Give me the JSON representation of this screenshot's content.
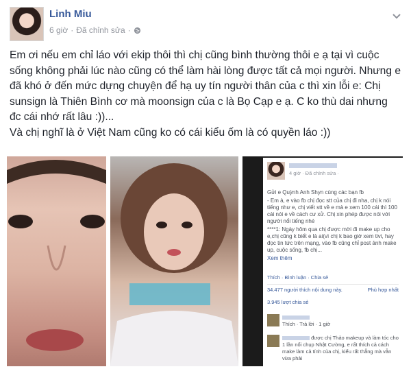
{
  "post": {
    "author": "Linh Miu",
    "time": "6 giờ",
    "separator": "·",
    "edited": "Đã chỉnh sửa",
    "privacy_sep": "·",
    "icons": {
      "privacy": "globe-icon",
      "menu": "chevron-down-icon"
    },
    "paragraphs": [
      "Em ơi nếu em chỉ láo với ekip thôi thì chị cũng bình thường thôi e ạ tại vì cuộc sống không phải lúc nào cũng có thể làm hài lòng được tất cả mọi người. Nhưng e đã khó ở đến mức dựng chuyện để hạ uy tín người thân của c thì xin lỗi e: Chị sunsign là Thiên Bình cơ mà moonsign của c là Bọ Cạp e ạ. C ko thù dai nhưng đc cái nhớ rất lâu :))...",
      "Và chị nghĩ là ở Việt Nam cũng ko có cái kiểu ốm là có quyền láo :))"
    ]
  },
  "embedded_screenshot": {
    "meta": "4 giờ · Đã chỉnh sửa ·",
    "text": [
      "Gửi e Quỳnh Anh Shyn cùng các bạn fb",
      "- Em à, e vào fb chị đọc stt của chị đi nha, chị k nói tiếng như e, chị viết stt về e mà e xem 100 cái thì 100 cái nói e về cách cư xử. Chị xin phép được nói với người nổi tiếng nhé",
      "****1: Ngày hôm qua chị được mời đi make up cho e,chị cũng k biết e là ai(vì chị k bao giờ xem tivi, hay đọc tin tức trên mạng, vào fb cũng chỉ post ảnh make up, cuộc sống, fb chị...",
      "Xem thêm"
    ],
    "actions": "Thích · Bình luận · Chia sẻ",
    "likes": "34.477 người thích nội dung này.",
    "top": "Phù hợp nhất",
    "shares": "3.945 lượt chia sẻ",
    "comment1": "Thích · Trả lời · 1 giờ",
    "comment2": "được chị Thảo makeup và làm tóc cho 1 lần nổi chụp Nhật Cường, e rất thích cả cách make làm cả tính của chị, kiểu rất thẳng mà vẫn vừa phải"
  }
}
